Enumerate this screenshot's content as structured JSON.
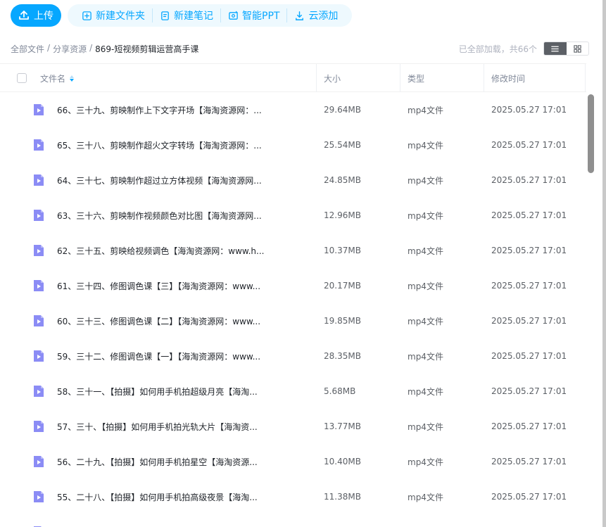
{
  "toolbar": {
    "upload_label": "上传",
    "actions": [
      {
        "label": "新建文件夹",
        "icon": "new-folder-icon"
      },
      {
        "label": "新建笔记",
        "icon": "new-note-icon"
      },
      {
        "label": "智能PPT",
        "icon": "smart-ppt-icon"
      },
      {
        "label": "云添加",
        "icon": "cloud-add-icon"
      }
    ]
  },
  "breadcrumb": {
    "items": [
      "全部文件",
      "分享资源"
    ],
    "separator": "/",
    "current": "869-短视频剪辑运营高手课"
  },
  "status": {
    "loaded_text": "已全部加载，共66个"
  },
  "view_toggle": {
    "active": "list",
    "options": [
      "list-view-icon",
      "grid-view-icon"
    ]
  },
  "table": {
    "columns": {
      "name": "文件名",
      "size": "大小",
      "type": "类型",
      "modified": "修改时间"
    },
    "rows": [
      {
        "name": "66、三十九、剪映制作上下文字开场【海淘资源网：...",
        "size": "29.64MB",
        "type": "mp4文件",
        "modified": "2025.05.27 17:01"
      },
      {
        "name": "65、三十八、剪映制作超火文字转场【海淘资源网：...",
        "size": "25.54MB",
        "type": "mp4文件",
        "modified": "2025.05.27 17:01"
      },
      {
        "name": "64、三十七、剪映制作超过立方体视频【海淘资源网...",
        "size": "24.85MB",
        "type": "mp4文件",
        "modified": "2025.05.27 17:01"
      },
      {
        "name": "63、三十六、剪映制作视频颜色对比图【海淘资源网...",
        "size": "12.96MB",
        "type": "mp4文件",
        "modified": "2025.05.27 17:01"
      },
      {
        "name": "62、三十五、剪映给视频调色【海淘资源网：www.h...",
        "size": "10.37MB",
        "type": "mp4文件",
        "modified": "2025.05.27 17:01"
      },
      {
        "name": "61、三十四、修图调色课【三】【海淘资源网：www...",
        "size": "20.17MB",
        "type": "mp4文件",
        "modified": "2025.05.27 17:01"
      },
      {
        "name": "60、三十三、修图调色课【二】【海淘资源网：www...",
        "size": "19.85MB",
        "type": "mp4文件",
        "modified": "2025.05.27 17:01"
      },
      {
        "name": "59、三十二、修图调色课【一】【海淘资源网：www...",
        "size": "28.35MB",
        "type": "mp4文件",
        "modified": "2025.05.27 17:01"
      },
      {
        "name": "58、三十一、【拍摄】如何用手机拍超级月亮【海淘...",
        "size": "5.68MB",
        "type": "mp4文件",
        "modified": "2025.05.27 17:01"
      },
      {
        "name": "57、三十、【拍摄】如何用手机拍光轨大片【海淘资...",
        "size": "13.77MB",
        "type": "mp4文件",
        "modified": "2025.05.27 17:01"
      },
      {
        "name": "56、二十九、【拍摄】如何用手机拍星空【海淘资源...",
        "size": "10.40MB",
        "type": "mp4文件",
        "modified": "2025.05.27 17:01"
      },
      {
        "name": "55、二十八、【拍摄】如何用手机拍高级夜景【海淘...",
        "size": "11.38MB",
        "type": "mp4文件",
        "modified": "2025.05.27 17:01"
      }
    ]
  },
  "colors": {
    "accent": "#06a7ff",
    "file_icon": "#8b8cf5",
    "text_secondary": "#818999"
  }
}
